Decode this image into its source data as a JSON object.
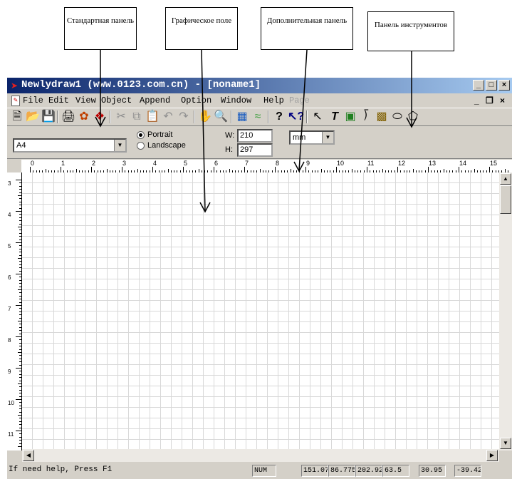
{
  "callouts": [
    {
      "text": "Стандартная панель"
    },
    {
      "text": "Графическое поле"
    },
    {
      "text": "Дополнительная панель"
    },
    {
      "text": "Панель инструментов"
    }
  ],
  "app": {
    "title": "Newlydraw1 (www.0123.com.cn) - [noname1]",
    "menu": [
      "File",
      "Edit",
      "View",
      "Object",
      "Append",
      "Option",
      "Window",
      "Help",
      "Page"
    ],
    "page_size": "A4",
    "orientation": {
      "portrait": "Portrait",
      "landscape": "Landscape",
      "selected": "Portrait"
    },
    "width_label": "W:",
    "width_value": "210",
    "height_label": "H:",
    "height_value": "297",
    "unit": "mm",
    "ruler_h": [
      "0",
      "1",
      "2",
      "3",
      "4",
      "5",
      "6",
      "7",
      "8",
      "9",
      "10",
      "11",
      "12",
      "13",
      "14",
      "15"
    ],
    "ruler_v": [
      "3",
      "4",
      "5",
      "6",
      "7",
      "8",
      "9",
      "10",
      "11"
    ],
    "status": {
      "help": "If need help, Press F1",
      "num": "NUM",
      "values": [
        "151.07",
        "86.775",
        "202.92",
        "63.5",
        "30.95",
        "-39.425"
      ]
    }
  }
}
